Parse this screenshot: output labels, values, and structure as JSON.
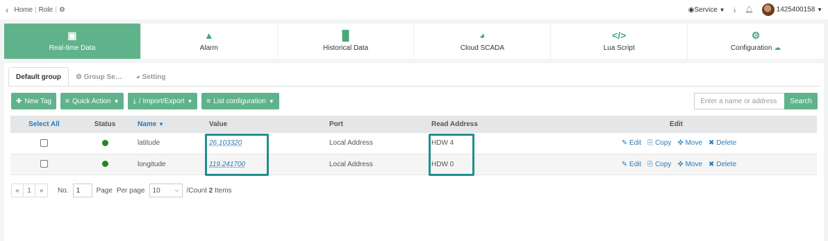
{
  "breadcrumb": {
    "home": "Home",
    "role": "Role"
  },
  "topbar": {
    "service_label": "Service",
    "user": "1425400158"
  },
  "modules": [
    {
      "icon": "camera-icon",
      "label": "Real-time Data"
    },
    {
      "icon": "warning-icon",
      "label": "Alarm"
    },
    {
      "icon": "bar-chart-icon",
      "label": "Historical Data"
    },
    {
      "icon": "dashboard-icon",
      "label": "Cloud SCADA"
    },
    {
      "icon": "code-icon",
      "label": "Lua Script"
    },
    {
      "icon": "gear-icon",
      "label": "Configuration"
    }
  ],
  "subtabs": [
    "Default group",
    "Group Se…",
    "Setting"
  ],
  "toolbar": {
    "new_tag": "New Tag",
    "quick_action": "Quick Action",
    "import_export": "/ Import/Export",
    "list_config": "List configuration",
    "search_placeholder": "Enter a name or address",
    "search_label": "Search"
  },
  "table": {
    "headers": {
      "select_all": "Select All",
      "status": "Status",
      "name": "Name",
      "value": "Value",
      "port": "Port",
      "read_address": "Read Address",
      "edit": "Edit"
    },
    "actions": {
      "edit": "Edit",
      "copy": "Copy",
      "move": "Move",
      "delete": "Delete"
    },
    "rows": [
      {
        "name": "latitude",
        "value": "26.103320",
        "port": "Local Address",
        "read_address": "HDW 4"
      },
      {
        "name": "longitude",
        "value": "119.241700",
        "port": "Local Address",
        "read_address": "HDW 0"
      }
    ]
  },
  "pager": {
    "prev": "«",
    "page": "1",
    "next": "»",
    "no_label": "No.",
    "page_input": "1",
    "page_label": "Page",
    "per_page_label": "Per page",
    "per_page": "10",
    "count_prefix": "/Count",
    "count": "2",
    "count_suffix": "Items"
  },
  "colors": {
    "accent": "#5fb38b",
    "link": "#2a7ab8",
    "highlight": "#1f8f8b",
    "status_ok": "#1e8a1e"
  }
}
